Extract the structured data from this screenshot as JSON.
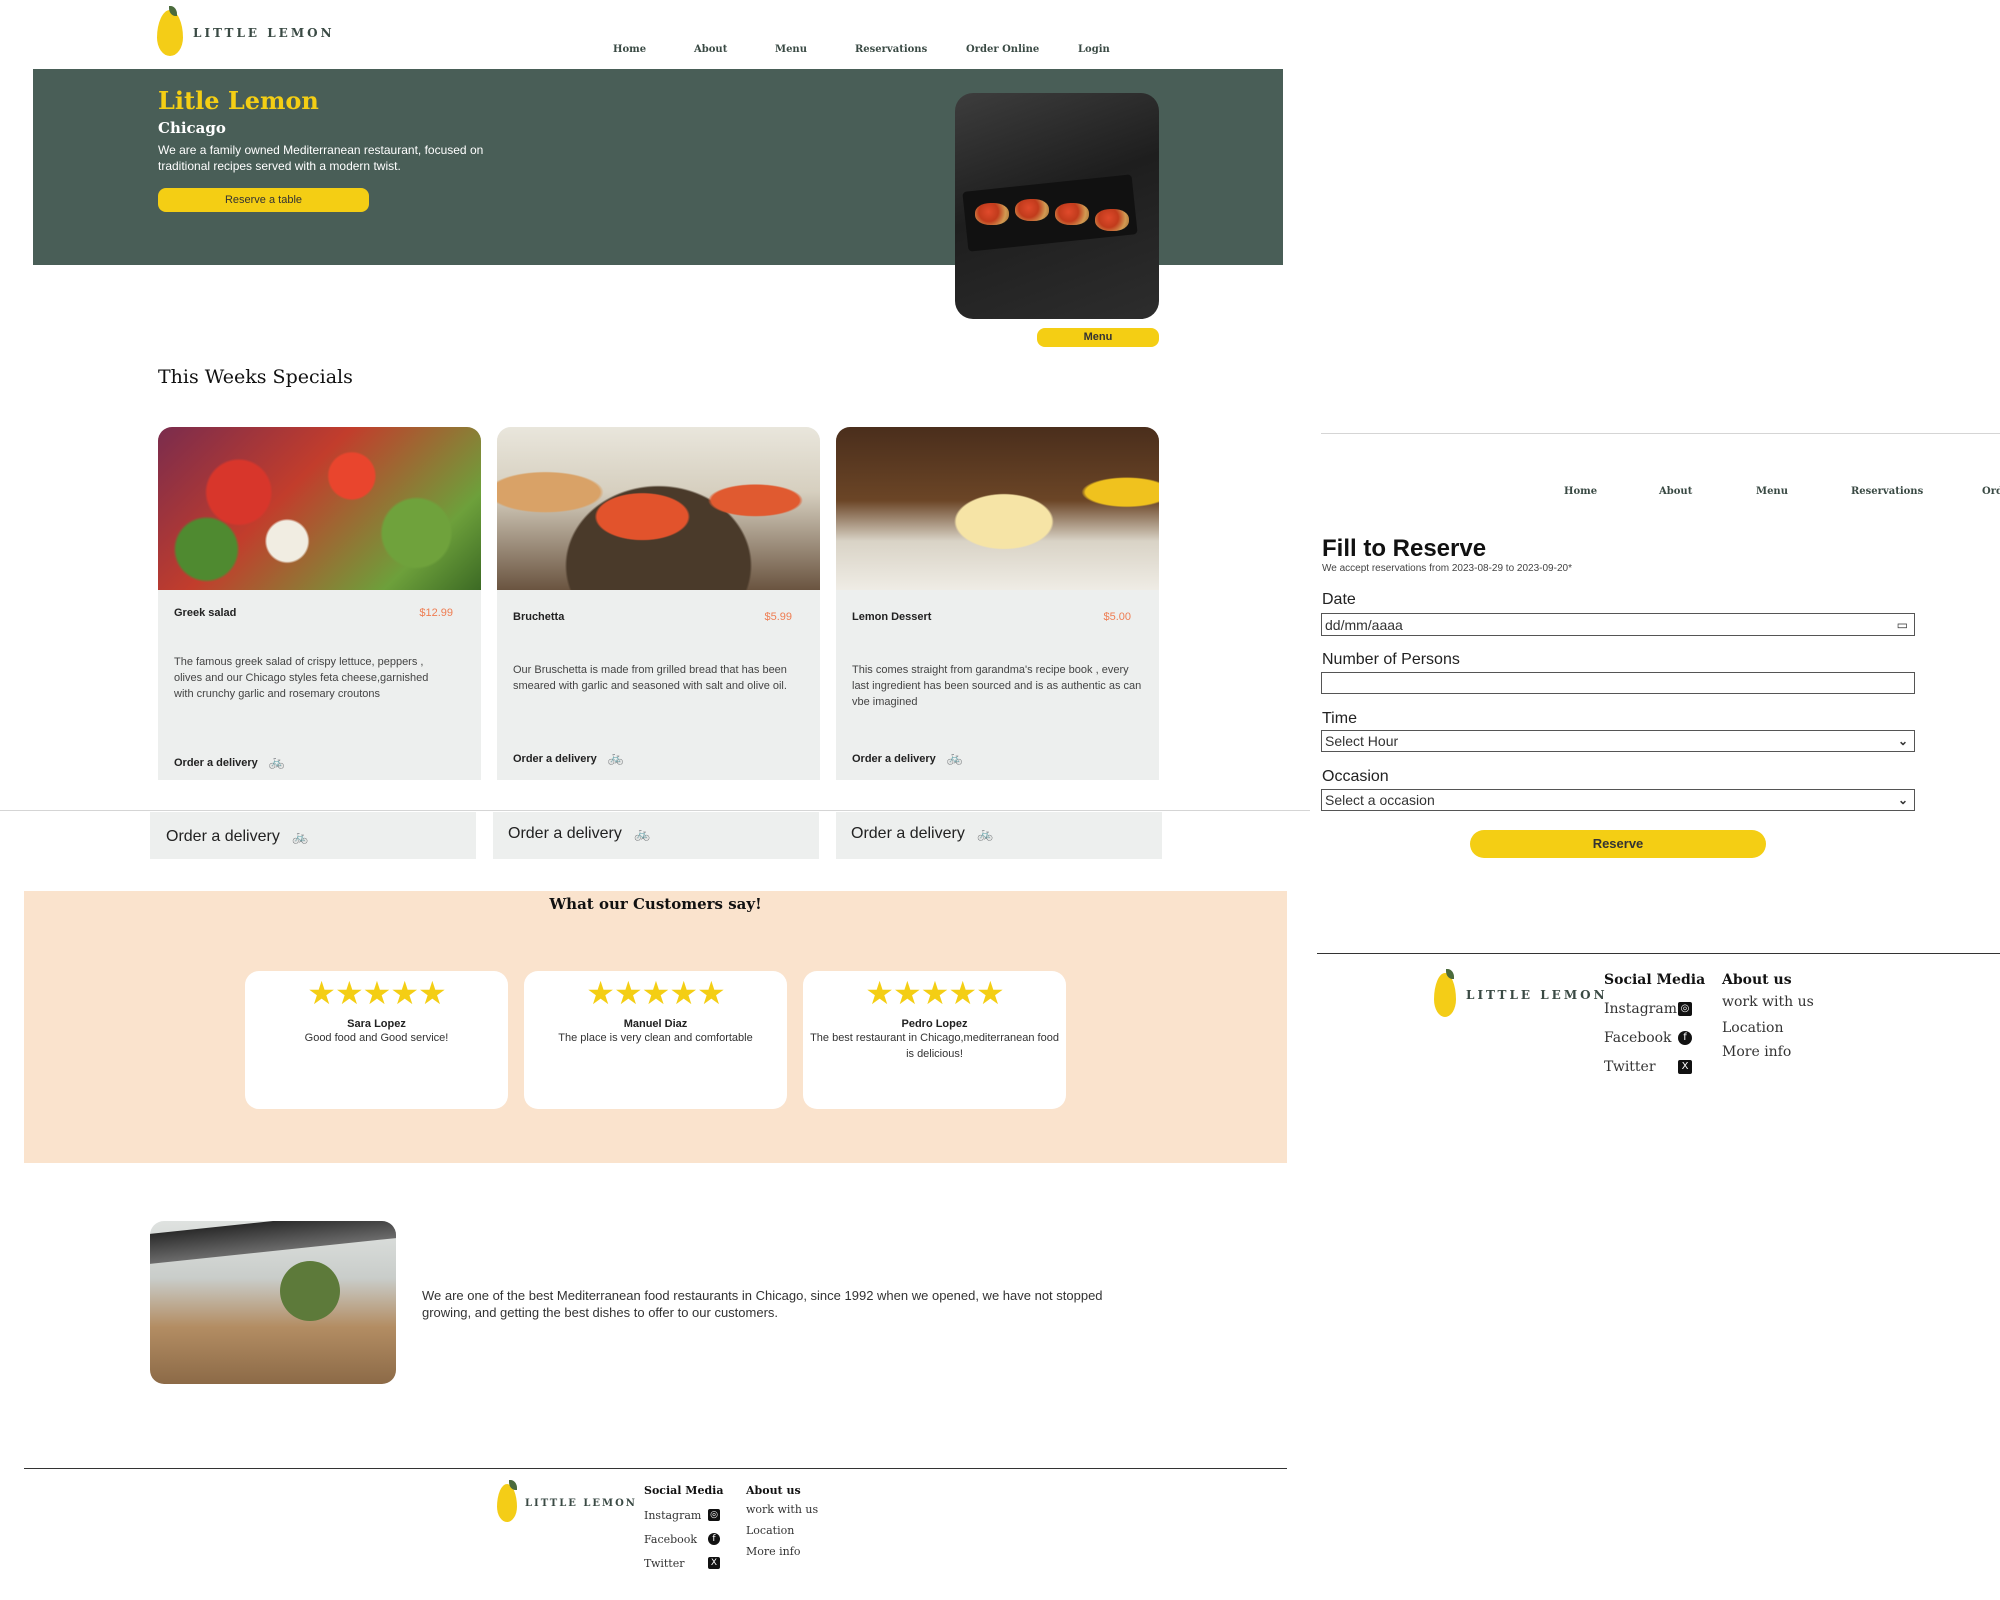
{
  "brand": {
    "logo_text": "LITTLE LEMON"
  },
  "nav": {
    "items": [
      "Home",
      "About",
      "Menu",
      "Reservations",
      "Order Online",
      "Login"
    ],
    "items_right": [
      "Home",
      "About",
      "Menu",
      "Reservations",
      "Ord"
    ]
  },
  "hero": {
    "title": "Litle Lemon",
    "city": "Chicago",
    "description": "We are a family owned Mediterranean restaurant, focused on traditional recipes served with a modern twist.",
    "reserve_button": "Reserve a table",
    "menu_button": "Menu"
  },
  "specials": {
    "heading": "This Weeks Specials",
    "cards": [
      {
        "name": "Greek salad",
        "price": "$12.99",
        "description": "The famous greek salad of crispy lettuce, peppers , olives and our Chicago styles feta cheese,garnished with crunchy garlic and rosemary croutons",
        "order": "Order a delivery"
      },
      {
        "name": "Bruchetta",
        "price": "$5.99",
        "description": "Our Bruschetta is made from grilled bread that has been smeared with garlic and seasoned with salt and olive oil.",
        "order": "Order a delivery"
      },
      {
        "name": "Lemon Dessert",
        "price": "$5.00",
        "description": "This comes straight from garandma's recipe book , every last ingredient has been sourced and is as authentic as can vbe imagined",
        "order": "Order a delivery"
      }
    ],
    "strip_order": [
      "Order a delivery",
      "Order a delivery",
      "Order a delivery"
    ]
  },
  "testimonials": {
    "heading": "What our Customers say!",
    "items": [
      {
        "stars": "★★★★★",
        "rating": 5,
        "name": "Sara Lopez",
        "text": "Good food and Good service!"
      },
      {
        "stars": "★★★★★",
        "rating": 5,
        "name": "Manuel Diaz",
        "text": "The place is very clean and comfortable"
      },
      {
        "stars": "★★★★★",
        "rating": 5,
        "name": "Pedro Lopez",
        "text": "The best restaurant in Chicago,mediterranean food is delicious!"
      }
    ]
  },
  "about": {
    "text": "We are one of the best Mediterranean food restaurants in Chicago, since 1992 when we opened, we have not stopped growing, and getting the best dishes to offer to our customers."
  },
  "footer": {
    "social_heading": "Social Media",
    "social": [
      "Instagram",
      "Facebook",
      "Twitter"
    ],
    "about_heading": "About us",
    "about_links": [
      "work with us",
      "Location",
      "More info"
    ]
  },
  "reservation": {
    "title": "Fill to Reserve",
    "note": "We accept reservations from 2023-08-29 to 2023-09-20*",
    "date_label": "Date",
    "date_placeholder": "dd/mm/aaaa",
    "persons_label": "Number of Persons",
    "time_label": "Time",
    "time_value": "Select Hour",
    "occasion_label": "Occasion",
    "occasion_value": "Select a occasion",
    "submit": "Reserve"
  },
  "colors": {
    "primary_green": "#495e57",
    "primary_yellow": "#f4ce14",
    "peach": "#fae3cd",
    "card_gray": "#edefee",
    "price_orange": "#ee7d52"
  },
  "icons": [
    "lemon-logo-icon",
    "bicycle-icon",
    "star-icon",
    "instagram-icon",
    "facebook-icon",
    "x-twitter-icon",
    "calendar-icon",
    "chevron-down-icon"
  ]
}
